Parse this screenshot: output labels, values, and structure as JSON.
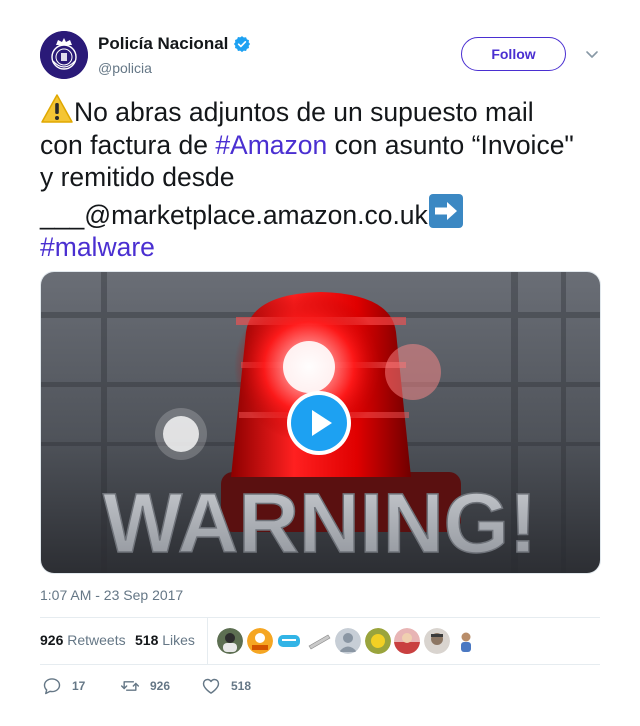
{
  "author": {
    "display_name": "Policía Nacional",
    "handle": "@policia",
    "follow_label": "Follow"
  },
  "tweet": {
    "line1_text": "No abras adjuntos de un supuesto mail",
    "line2_pre": "con factura de ",
    "line2_hashtag": "#Amazon",
    "line2_post": " con asunto “Invoice\"",
    "line3_text": "y remitido desde",
    "line4_text": "___@marketplace.amazon.co.uk",
    "line5_hashtag": "#malware",
    "emoji_start": "warning-sign",
    "emoji_end": "right-arrow"
  },
  "media": {
    "overlay_text": "WARNING!",
    "type": "video"
  },
  "timestamp": "1:07 AM - 23 Sep 2017",
  "stats": {
    "retweets_count": "926",
    "retweets_label": "Retweets",
    "likes_count": "518",
    "likes_label": "Likes",
    "liker_avatars": 9
  },
  "actions": {
    "reply_count": "17",
    "retweet_count": "926",
    "like_count": "518"
  },
  "colors": {
    "accent": "#4a2fd1",
    "verified": "#1da1f2",
    "play": "#1da1f2",
    "muted": "#657786"
  }
}
